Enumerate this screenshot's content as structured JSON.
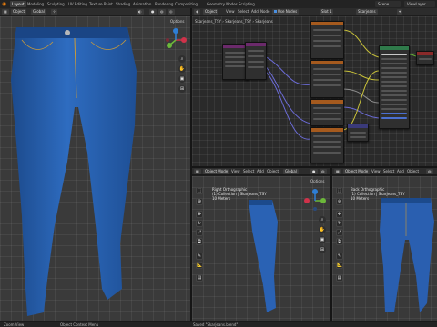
{
  "topbar": {
    "workspaces": [
      "Layout",
      "Modeling",
      "Sculpting",
      "UV Editing",
      "Texture Paint",
      "Shading",
      "Animation",
      "Rendering",
      "Compositing",
      "Geometry Nodes",
      "Scripting"
    ],
    "scene_label": "Scene",
    "view_layer_label": "ViewLayer"
  },
  "left_viewport": {
    "mode": "Object",
    "transform": "Global",
    "options_label": "Options"
  },
  "node_editor": {
    "mode": "Object",
    "menu": [
      "View",
      "Select",
      "Add",
      "Node"
    ],
    "use_nodes_label": "Use Nodes",
    "slot": "Slot 1",
    "material": "Skarjeans",
    "breadcrumb_object": "Skarjeans_TSY",
    "breadcrumb_mesh": "Skarjeans_TSY",
    "breadcrumb_material": "Skarjeans"
  },
  "mid_viewport": {
    "mode": "Object Mode",
    "menu": [
      "View",
      "Select",
      "Add",
      "Object"
    ],
    "transform": "Global",
    "options_label": "Options",
    "info_line1": "Right Orthographic",
    "info_line2": "(1) Collection | Skarjeans_TSY",
    "info_line3": "10 Meters"
  },
  "right_viewport": {
    "mode": "Object Mode",
    "menu": [
      "View",
      "Select",
      "Add",
      "Object"
    ],
    "info_line1": "Back Orthographic",
    "info_line2": "(1) Collection | Skarjeans_TSY",
    "info_line3": "10 Meters"
  },
  "statusbar": {
    "left": "Zoom View",
    "middle": "Object Context Menu",
    "message": "Saved \"Skarjeans.blend\""
  },
  "colors": {
    "jeans": "#2a62b4",
    "jeans_dark": "#1c4a8c",
    "axis_x": "#d0324a",
    "axis_y": "#6cb83a",
    "axis_z": "#2e7ed6",
    "wire_yellow": "#c9c23a",
    "wire_purple": "#6b6bd6",
    "node_header_green": "#2f7a4a",
    "node_header_red": "#8a2a2a",
    "node_header_orange": "#a55a1e"
  },
  "icons": [
    "blender-logo-icon",
    "select-box-icon",
    "cursor-icon",
    "move-icon",
    "rotate-icon",
    "scale-icon",
    "transform-icon",
    "annotate-icon",
    "measure-icon",
    "zoom-icon",
    "hand-icon",
    "camera-icon",
    "grid-icon",
    "search-icon"
  ]
}
